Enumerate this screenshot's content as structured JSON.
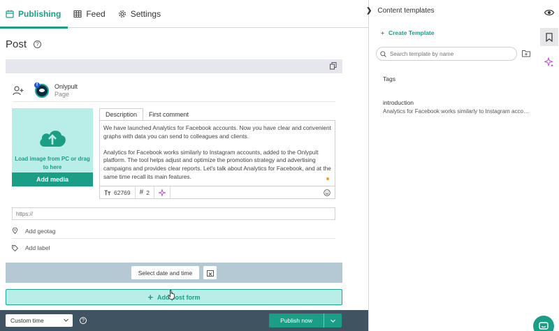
{
  "nav": {
    "tabs": [
      {
        "label": "Publishing",
        "icon": "calendar-icon",
        "active": true
      },
      {
        "label": "Feed",
        "icon": "grid-icon",
        "active": false
      },
      {
        "label": "Settings",
        "icon": "gear-icon",
        "active": false
      }
    ]
  },
  "post": {
    "title": "Post",
    "account": {
      "name": "Onlypult",
      "type": "Page"
    },
    "upload_text": "Load image from PC or drag to here",
    "add_media_label": "Add media",
    "tabs": [
      "Description",
      "First comment"
    ],
    "description_paragraphs": [
      "We have launched Analytics for Facebook accounts. Now you have clear and convenient graphs with data you can send to colleagues and clients.",
      "Analytics for Facebook works similarly to Instagram accounts, added to the Onlypult platform. The tool helps adjust and optimize the promotion strategy and advertising campaigns and provides clear reports. Let's talk about Analytics for Facebook, and at the same time recall its main features."
    ],
    "char_count": "62769",
    "hashtag_count": "2",
    "url_placeholder": "https://",
    "geotag_label": "Add geotag",
    "label_label": "Add label",
    "select_date_label": "Select date and time",
    "add_post_form_label": "Add post form"
  },
  "footer": {
    "time_select": "Custom time",
    "publish_label": "Publish now"
  },
  "templates": {
    "title": "Content templates",
    "create_label": "Create Template",
    "search_placeholder": "Search template by name",
    "tags_label": "Tags",
    "items": [
      {
        "title": "introduction",
        "preview": "Analytics for Facebook works similarly to Instagram accounts, added to the Onlypult platform."
      }
    ]
  },
  "colors": {
    "accent": "#1a9e86",
    "accent_light": "#b9ede8",
    "footer_bg": "#3f5360",
    "schedule_bg": "#b5c9d4"
  }
}
